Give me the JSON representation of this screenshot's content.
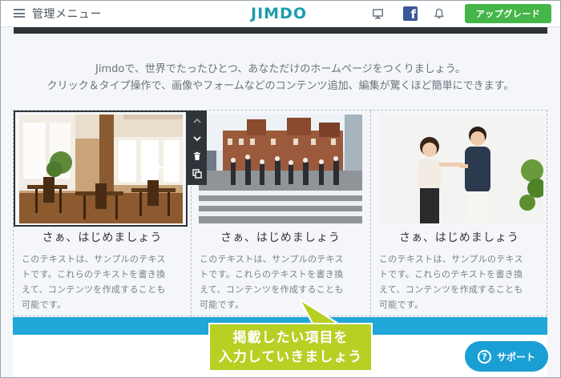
{
  "header": {
    "menu_label": "管理メニュー",
    "logo_text": "JIMDO",
    "upgrade_label": "アップグレード",
    "icons": [
      "hamburger-icon",
      "monitor-icon",
      "facebook-icon",
      "bell-icon"
    ]
  },
  "intro": {
    "line1": "Jimdoで、世界でたったひとつ、あなただけのホームページをつくりましょう。",
    "line2": "クリック＆タイプ操作で、画像やフォームなどのコンテンツ追加、編集が驚くほど簡単にできます。"
  },
  "cards": [
    {
      "title": "さぁ、はじめましょう",
      "text": [
        "このテキストは、サンプルのテキス",
        "トです。これらのテキストを書き換",
        "えて、コンテンツを作成することも",
        "可能です。"
      ]
    },
    {
      "title": "さぁ、はじめましょう",
      "text": [
        "このテキストは、サンプルのテキス",
        "トです。これらのテキストを書き換",
        "えて、コンテンツを作成することも",
        "可能です。"
      ]
    },
    {
      "title": "さぁ、はじめましょう",
      "text": [
        "このテキストは、サンプルのテキス",
        "トです。これらのテキストを書き換",
        "えて、コンテンツを作成することも",
        "可能です。"
      ]
    }
  ],
  "callout": {
    "line1": "掲載したい項目を",
    "line2": "入力していきましょう"
  },
  "support_label": "サポート",
  "colors": {
    "brand": "#1b9dad",
    "upgrade": "#45b649",
    "blue_strip": "#20a7d8",
    "callout": "#b8cf24",
    "support": "#1a9fd5",
    "toolbar": "#2f3438"
  }
}
